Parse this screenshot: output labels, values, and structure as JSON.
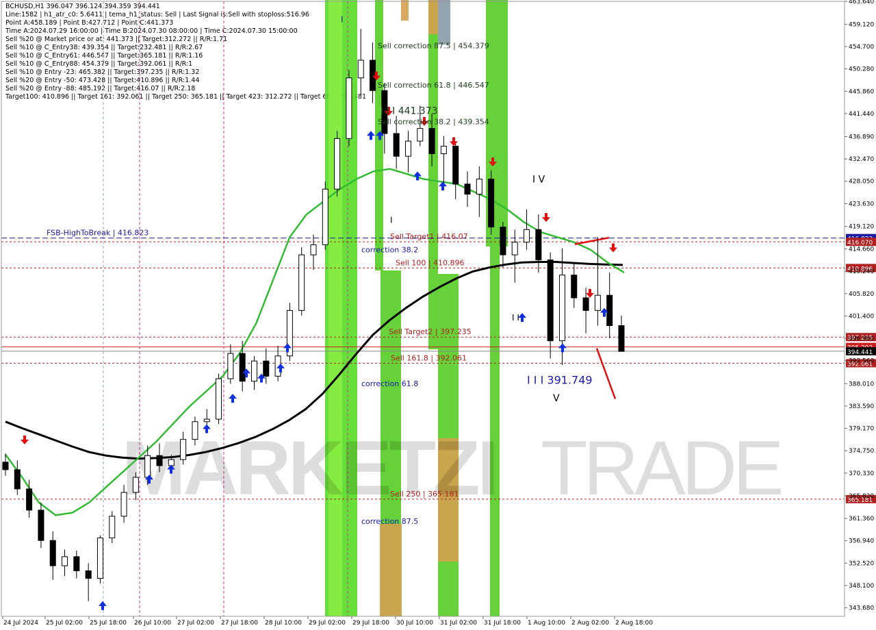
{
  "header": {
    "lines": [
      "BCHUSD,H1  396.047 396.124 394.359 394.441",
      "Line:1582  | h1_atr_c0: 5.6411  | tema_h1_status: Sell  | Last Signal is:Sell with stoploss:516.96",
      "Point A:458.189  | Point B:427.712  | Point C:441.373",
      "Time A:2024.07.29 16:00:00  | Time B:2024.07.30 08:00:00  | Time C:2024.07.30 15:00:00",
      "Sell %20 @ Market price or at: 441.373  || Target:312.272  || R/R:1.71",
      "Sell %10 @ C_Entry38: 439.354  || Target:232.481  || R/R:2.67",
      "Sell %10 @ C_Entry61: 446.547  || Target:365.181  || R/R:1.16",
      "Sell %10 @ C_Entry88: 454.379  || Target:392.061  || R/R:1",
      "Sell %10 @ Entry -23: 465.382  || Target:397.235  || R/R:1.32",
      "Sell %20 @ Entry -50: 473.428  || Target:410.896  || R/R:1.44",
      "Sell %20 @ Entry -88: 485.192  || Target:416.07  || R/R:2.18",
      "Target100: 410.896  || Target 161: 392.061  || Target 250: 365.181  || Target 423: 312.272  || Target 685: 232.481"
    ]
  },
  "watermark": {
    "left": "MARKETZI",
    "right": "TRADE"
  },
  "chart_data": {
    "type": "line",
    "symbol": "BCHUSD",
    "timeframe": "H1",
    "ylim": [
      342.0,
      463.64
    ],
    "y_ticks": [
      463.64,
      459.12,
      454.7,
      450.28,
      445.86,
      441.44,
      436.89,
      432.47,
      428.05,
      423.63,
      419.12,
      414.66,
      410.24,
      405.82,
      401.4,
      396.98,
      392.56,
      388.01,
      383.59,
      379.17,
      374.75,
      370.33,
      365.82,
      361.36,
      356.94,
      352.52,
      348.1,
      343.68
    ],
    "x_labels": [
      "24 Jul 2024",
      "25 Jul 02:00",
      "25 Jul 18:00",
      "26 Jul 10:00",
      "27 Jul 02:00",
      "27 Jul 18:00",
      "28 Jul 10:00",
      "29 Jul 02:00",
      "29 Jul 18:00",
      "30 Jul 10:00",
      "31 Jul 02:00",
      "31 Jul 18:00",
      "1 Aug 10:00",
      "2 Aug 02:00",
      "2 Aug 18:00"
    ],
    "price_series": [
      {
        "t": 0,
        "o": 372.5,
        "h": 374.2,
        "l": 369.8,
        "c": 371.0
      },
      {
        "t": 1,
        "o": 371.0,
        "h": 372.8,
        "l": 366.0,
        "c": 367.2
      },
      {
        "t": 2,
        "o": 367.2,
        "h": 369.0,
        "l": 361.5,
        "c": 363.0
      },
      {
        "t": 3,
        "o": 363.0,
        "h": 364.5,
        "l": 355.5,
        "c": 357.0
      },
      {
        "t": 4,
        "o": 357.0,
        "h": 358.8,
        "l": 349.2,
        "c": 352.0
      },
      {
        "t": 5,
        "o": 352.0,
        "h": 355.2,
        "l": 350.0,
        "c": 353.8
      },
      {
        "t": 6,
        "o": 353.8,
        "h": 355.0,
        "l": 349.5,
        "c": 351.0
      },
      {
        "t": 7,
        "o": 351.0,
        "h": 352.5,
        "l": 345.0,
        "c": 349.5
      },
      {
        "t": 8,
        "o": 349.5,
        "h": 358.0,
        "l": 348.5,
        "c": 357.5
      },
      {
        "t": 9,
        "o": 357.5,
        "h": 362.8,
        "l": 356.5,
        "c": 361.8
      },
      {
        "t": 10,
        "o": 361.8,
        "h": 368.0,
        "l": 360.5,
        "c": 366.5
      },
      {
        "t": 11,
        "o": 366.5,
        "h": 370.5,
        "l": 365.0,
        "c": 369.5
      },
      {
        "t": 12,
        "o": 369.5,
        "h": 375.8,
        "l": 368.0,
        "c": 373.8
      },
      {
        "t": 13,
        "o": 373.8,
        "h": 376.2,
        "l": 370.5,
        "c": 371.8
      },
      {
        "t": 14,
        "o": 371.8,
        "h": 374.0,
        "l": 370.2,
        "c": 373.0
      },
      {
        "t": 15,
        "o": 373.0,
        "h": 378.5,
        "l": 372.0,
        "c": 377.0
      },
      {
        "t": 16,
        "o": 377.0,
        "h": 381.5,
        "l": 375.8,
        "c": 380.5
      },
      {
        "t": 17,
        "o": 380.5,
        "h": 383.0,
        "l": 378.8,
        "c": 381.0
      },
      {
        "t": 18,
        "o": 381.0,
        "h": 390.0,
        "l": 380.0,
        "c": 389.0
      },
      {
        "t": 19,
        "o": 389.0,
        "h": 395.8,
        "l": 388.0,
        "c": 394.0
      },
      {
        "t": 20,
        "o": 394.0,
        "h": 396.5,
        "l": 386.5,
        "c": 388.5
      },
      {
        "t": 21,
        "o": 388.5,
        "h": 393.5,
        "l": 386.8,
        "c": 392.5
      },
      {
        "t": 22,
        "o": 392.5,
        "h": 395.0,
        "l": 388.0,
        "c": 389.5
      },
      {
        "t": 23,
        "o": 389.5,
        "h": 395.5,
        "l": 388.5,
        "c": 393.5
      },
      {
        "t": 24,
        "o": 393.5,
        "h": 404.0,
        "l": 392.5,
        "c": 402.5
      },
      {
        "t": 25,
        "o": 402.5,
        "h": 415.0,
        "l": 401.5,
        "c": 413.5
      },
      {
        "t": 26,
        "o": 413.5,
        "h": 417.5,
        "l": 410.5,
        "c": 415.5
      },
      {
        "t": 27,
        "o": 415.5,
        "h": 428.0,
        "l": 414.5,
        "c": 426.5
      },
      {
        "t": 28,
        "o": 426.5,
        "h": 438.0,
        "l": 425.0,
        "c": 436.5
      },
      {
        "t": 29,
        "o": 436.5,
        "h": 450.0,
        "l": 435.0,
        "c": 448.5
      },
      {
        "t": 30,
        "o": 448.5,
        "h": 458.2,
        "l": 445.0,
        "c": 452.0
      },
      {
        "t": 31,
        "o": 452.0,
        "h": 455.5,
        "l": 443.5,
        "c": 446.0
      },
      {
        "t": 32,
        "o": 446.0,
        "h": 447.5,
        "l": 433.5,
        "c": 437.5
      },
      {
        "t": 33,
        "o": 437.5,
        "h": 441.0,
        "l": 430.5,
        "c": 433.0
      },
      {
        "t": 34,
        "o": 433.0,
        "h": 438.0,
        "l": 429.8,
        "c": 436.0
      },
      {
        "t": 35,
        "o": 436.0,
        "h": 443.0,
        "l": 435.0,
        "c": 438.5
      },
      {
        "t": 36,
        "o": 438.5,
        "h": 441.4,
        "l": 431.0,
        "c": 433.5
      },
      {
        "t": 37,
        "o": 433.5,
        "h": 437.0,
        "l": 427.7,
        "c": 435.0
      },
      {
        "t": 38,
        "o": 435.0,
        "h": 435.5,
        "l": 424.5,
        "c": 427.5
      },
      {
        "t": 39,
        "o": 427.5,
        "h": 430.0,
        "l": 423.0,
        "c": 425.5
      },
      {
        "t": 40,
        "o": 425.5,
        "h": 431.0,
        "l": 421.0,
        "c": 428.5
      },
      {
        "t": 41,
        "o": 428.5,
        "h": 430.2,
        "l": 417.5,
        "c": 419.0
      },
      {
        "t": 42,
        "o": 419.0,
        "h": 420.0,
        "l": 411.0,
        "c": 413.5
      },
      {
        "t": 43,
        "o": 413.5,
        "h": 418.5,
        "l": 408.0,
        "c": 416.0
      },
      {
        "t": 44,
        "o": 416.0,
        "h": 422.5,
        "l": 414.5,
        "c": 418.5
      },
      {
        "t": 45,
        "o": 418.5,
        "h": 421.5,
        "l": 410.0,
        "c": 412.5
      },
      {
        "t": 46,
        "o": 412.5,
        "h": 414.0,
        "l": 393.0,
        "c": 396.5
      },
      {
        "t": 47,
        "o": 396.5,
        "h": 414.8,
        "l": 391.7,
        "c": 409.5
      },
      {
        "t": 48,
        "o": 409.5,
        "h": 412.0,
        "l": 403.0,
        "c": 405.0
      },
      {
        "t": 49,
        "o": 405.0,
        "h": 407.0,
        "l": 398.0,
        "c": 402.5
      },
      {
        "t": 50,
        "o": 402.5,
        "h": 417.0,
        "l": 399.5,
        "c": 405.5
      },
      {
        "t": 51,
        "o": 405.5,
        "h": 410.0,
        "l": 397.0,
        "c": 399.5
      },
      {
        "t": 52,
        "o": 399.5,
        "h": 401.5,
        "l": 394.4,
        "c": 394.4
      }
    ],
    "series": [
      {
        "name": "",
        "color": "#000000",
        "values": [
          380.5,
          379.2,
          378.0,
          376.8,
          375.6,
          374.5,
          373.8,
          373.4,
          373.2,
          373.3,
          373.5,
          373.9,
          374.5,
          375.3,
          376.3,
          377.5,
          379.0,
          380.8,
          383.0,
          386.0,
          389.8,
          393.8,
          397.6,
          400.5,
          403.0,
          405.2,
          407.1,
          408.8,
          410.2,
          411.0,
          411.6,
          412.0,
          412.1,
          412.1,
          411.9,
          411.7,
          411.6,
          411.5
        ]
      },
      {
        "name": "",
        "color": "#33bb33",
        "values": [
          374.0,
          369.5,
          364.5,
          362.0,
          362.5,
          364.5,
          367.5,
          370.5,
          373.5,
          376.5,
          380.0,
          383.5,
          386.5,
          389.5,
          394.0,
          400.0,
          408.5,
          417.0,
          421.5,
          424.0,
          426.5,
          428.5,
          430.0,
          430.5,
          429.5,
          428.5,
          428.0,
          427.5,
          426.0,
          424.5,
          422.5,
          420.0,
          418.0,
          417.0,
          416.0,
          414.5,
          412.0,
          410.0
        ]
      }
    ],
    "levels": [
      {
        "label": "FSB-HighToBreak | 416.823",
        "value": 416.823,
        "color": "#1a1aa0",
        "style": "dash",
        "axis_label": "416.823",
        "axis_bg": "#1a1aa0"
      },
      {
        "label": "Sell Target1 | 416.07",
        "value": 416.07,
        "color": "#b02020",
        "style": "dot",
        "axis_label": "416.070",
        "axis_bg": "#b02020"
      },
      {
        "label": "Sell 100 | 410.896",
        "value": 410.896,
        "color": "#b02020",
        "style": "dot",
        "axis_label": "410.896",
        "axis_bg": "#b02020"
      },
      {
        "label": "Sell Target2 | 397.235",
        "value": 397.235,
        "color": "#b02020",
        "style": "dot",
        "axis_label": "397.235",
        "axis_bg": "#b02020"
      },
      {
        "label": "",
        "value": 395.292,
        "color": "#cc2020",
        "style": "solid",
        "axis_label": "395.292",
        "axis_bg": "#cc2020"
      },
      {
        "label": "",
        "value": 394.441,
        "color": "#888888",
        "style": "solid",
        "axis_label": "394.441",
        "axis_bg": "#000000"
      },
      {
        "label": "Sell 161.8 | 392.061",
        "value": 392.061,
        "color": "#b02020",
        "style": "dot",
        "axis_label": "392.061",
        "axis_bg": "#b02020"
      },
      {
        "label": "Sell 250 | 365.181",
        "value": 365.181,
        "color": "#b02020",
        "style": "dot",
        "axis_label": "365.181",
        "axis_bg": "#b02020"
      }
    ],
    "annotations": [
      {
        "text": "Sell correction 87.5 | 454.379",
        "value": 454.379,
        "color": "#1d3d1d"
      },
      {
        "text": "I I I 441.373",
        "value": 441.373,
        "color": "#1d3d1d"
      },
      {
        "text": "Sell correction 61.8 | 446.547",
        "value": 446.547,
        "color": "#1d3d1d"
      },
      {
        "text": "Sell correction 38.2 | 439.354",
        "value": 439.354,
        "color": "#1d3d1d"
      },
      {
        "text": "correction 38.2",
        "value": 414.0,
        "color": "#1a1ab0"
      },
      {
        "text": "correction 61.8",
        "value": 387.5,
        "color": "#1a1ab0"
      },
      {
        "text": "correction 87.5",
        "value": 360.3,
        "color": "#1a1ab0"
      },
      {
        "text": "I I I 391.749",
        "value": 388.0,
        "color": "#1a1ab0"
      },
      {
        "text": "I V",
        "value": 427.8,
        "color": "#000000"
      },
      {
        "text": "V",
        "value": 384.5,
        "color": "#000000"
      },
      {
        "text": "I",
        "value": 459.5,
        "color": "#1a1ab0"
      },
      {
        "text": "I",
        "value": 419.8,
        "color": "#000000"
      },
      {
        "text": "I I",
        "value": 400.5,
        "color": "#000000"
      }
    ]
  }
}
